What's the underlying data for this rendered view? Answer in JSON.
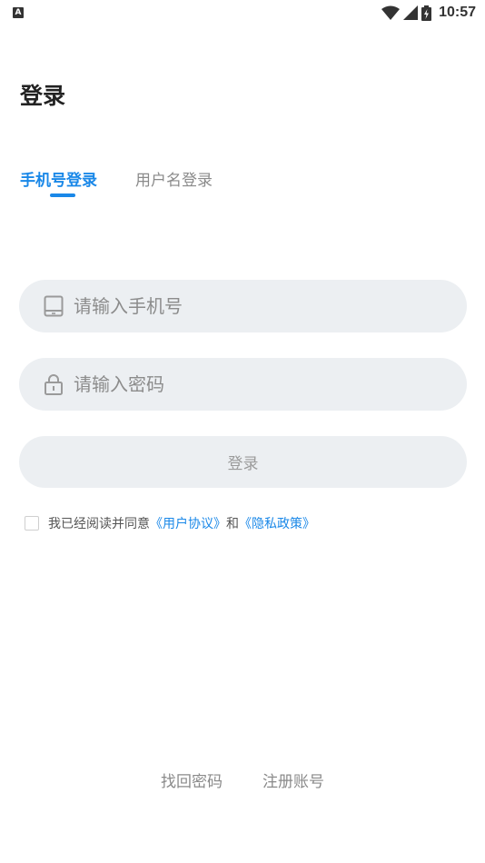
{
  "status_bar": {
    "left_icon": "A",
    "time": "10:57",
    "icons": [
      "wifi-icon",
      "signal-icon",
      "battery-icon"
    ]
  },
  "page": {
    "title": "登录"
  },
  "tabs": [
    {
      "label": "手机号登录",
      "active": true
    },
    {
      "label": "用户名登录",
      "active": false
    }
  ],
  "form": {
    "phone_placeholder": "请输入手机号",
    "password_placeholder": "请输入密码",
    "login_button": "登录"
  },
  "agreement": {
    "prefix": "我已经阅读并同意",
    "user_agreement": "《用户协议》",
    "conjunction": "和",
    "privacy_policy": "《隐私政策》",
    "checked": false
  },
  "footer": {
    "forgot_password": "找回密码",
    "register": "注册账号"
  },
  "colors": {
    "accent": "#1a88e8",
    "field_bg": "#eceff2",
    "muted_text": "#8a8a8a"
  }
}
